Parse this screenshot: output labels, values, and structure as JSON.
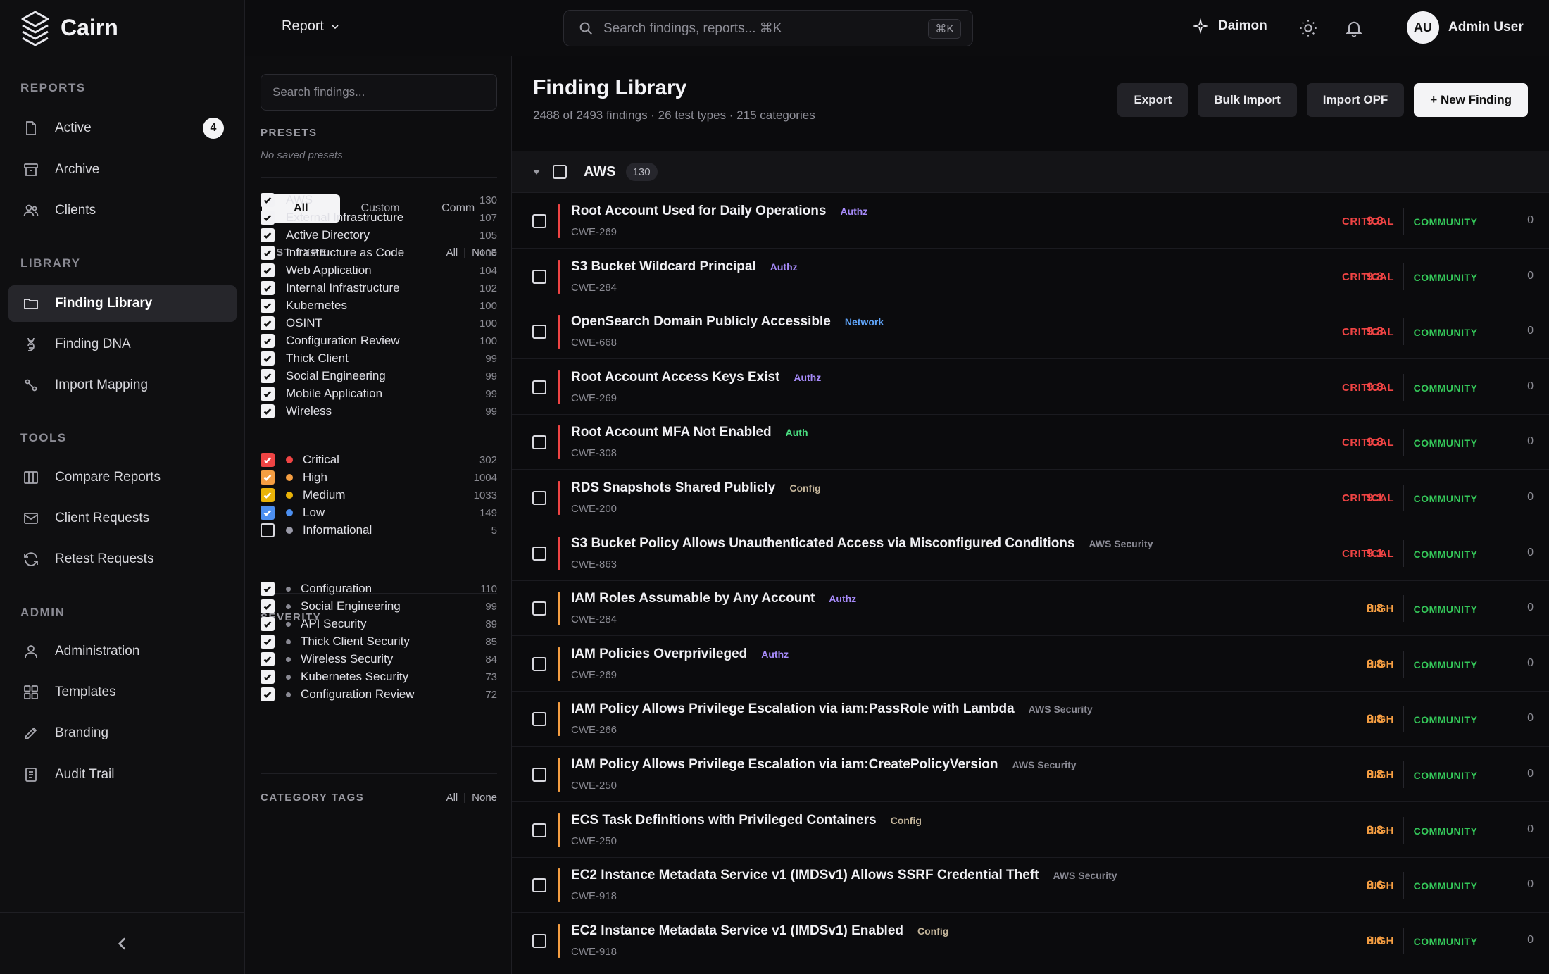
{
  "app": {
    "name": "Cairn"
  },
  "topbar": {
    "report_menu": "Report",
    "search_placeholder": "Search findings, reports... ⌘K",
    "search_shortcut": "⌘K",
    "assistant": "Daimon",
    "user_initials": "AU",
    "user_name": "Admin User"
  },
  "sidebar": {
    "sections": {
      "reports": "REPORTS",
      "library": "LIBRARY",
      "tools": "TOOLS",
      "admin": "ADMIN"
    },
    "items": [
      {
        "label": "Active",
        "icon": "document-icon",
        "badge": "4"
      },
      {
        "label": "Archive",
        "icon": "archive-icon"
      },
      {
        "label": "Clients",
        "icon": "users-icon"
      },
      {
        "label": "Finding Library",
        "icon": "folder-icon",
        "active": true
      },
      {
        "label": "Finding DNA",
        "icon": "dna-icon"
      },
      {
        "label": "Import Mapping",
        "icon": "mapping-icon"
      },
      {
        "label": "Compare Reports",
        "icon": "columns-icon"
      },
      {
        "label": "Client Requests",
        "icon": "mail-icon"
      },
      {
        "label": "Retest Requests",
        "icon": "refresh-icon"
      },
      {
        "label": "Administration",
        "icon": "user-icon"
      },
      {
        "label": "Templates",
        "icon": "grid-icon"
      },
      {
        "label": "Branding",
        "icon": "pen-icon"
      },
      {
        "label": "Audit Trail",
        "icon": "clipboard-icon"
      }
    ]
  },
  "filters": {
    "search_placeholder": "Search findings...",
    "presets_label": "PRESETS",
    "presets_empty": "No saved presets",
    "scope_tabs": [
      "All",
      "Custom",
      "Comm"
    ],
    "test_type_label": "TEST TYPE",
    "all": "All",
    "none": "None",
    "test_types": [
      {
        "label": "AWS",
        "count": "130"
      },
      {
        "label": "External Infrastructure",
        "count": "107"
      },
      {
        "label": "Active Directory",
        "count": "105"
      },
      {
        "label": "Infrastructure as Code",
        "count": "105"
      },
      {
        "label": "Web Application",
        "count": "104"
      },
      {
        "label": "Internal Infrastructure",
        "count": "102"
      },
      {
        "label": "Kubernetes",
        "count": "100"
      },
      {
        "label": "OSINT",
        "count": "100"
      },
      {
        "label": "Configuration Review",
        "count": "100"
      },
      {
        "label": "Thick Client",
        "count": "99"
      },
      {
        "label": "Social Engineering",
        "count": "99"
      },
      {
        "label": "Mobile Application",
        "count": "99"
      },
      {
        "label": "Wireless",
        "count": "99"
      }
    ],
    "severity_label": "SEVERITY",
    "severities": [
      {
        "label": "Critical",
        "count": "302",
        "color": "#ef4444",
        "checked": true
      },
      {
        "label": "High",
        "count": "1004",
        "color": "#f59e42",
        "checked": true
      },
      {
        "label": "Medium",
        "count": "1033",
        "color": "#eab308",
        "checked": true
      },
      {
        "label": "Low",
        "count": "149",
        "color": "#4c8ff0",
        "checked": true
      },
      {
        "label": "Informational",
        "count": "5",
        "color": "#9a9aa8",
        "checked": false
      }
    ],
    "category_label": "CATEGORY TAGS",
    "categories": [
      {
        "label": "Configuration",
        "count": "110"
      },
      {
        "label": "Social Engineering",
        "count": "99"
      },
      {
        "label": "API Security",
        "count": "89"
      },
      {
        "label": "Thick Client Security",
        "count": "85"
      },
      {
        "label": "Wireless Security",
        "count": "84"
      },
      {
        "label": "Kubernetes Security",
        "count": "73"
      },
      {
        "label": "Configuration Review",
        "count": "72"
      }
    ]
  },
  "main": {
    "title": "Finding Library",
    "subtitle": "2488 of 2493 findings · 26 test types · 215 categories",
    "actions": {
      "export": "Export",
      "bulk_import": "Bulk Import",
      "import_opf": "Import OPF",
      "new_finding": "+ New Finding"
    },
    "group": {
      "name": "AWS",
      "count": "130"
    },
    "findings": [
      {
        "title": "Root Account Used for Daily Operations",
        "tag": "Authz",
        "cwe": "CWE-269",
        "severity": "CRITICAL",
        "score": "9.8",
        "source": "COMMUNITY",
        "uses": "0"
      },
      {
        "title": "S3 Bucket Wildcard Principal",
        "tag": "Authz",
        "cwe": "CWE-284",
        "severity": "CRITICAL",
        "score": "9.8",
        "source": "COMMUNITY",
        "uses": "0"
      },
      {
        "title": "OpenSearch Domain Publicly Accessible",
        "tag": "Network",
        "cwe": "CWE-668",
        "severity": "CRITICAL",
        "score": "9.8",
        "source": "COMMUNITY",
        "uses": "0"
      },
      {
        "title": "Root Account Access Keys Exist",
        "tag": "Authz",
        "cwe": "CWE-269",
        "severity": "CRITICAL",
        "score": "9.8",
        "source": "COMMUNITY",
        "uses": "0"
      },
      {
        "title": "Root Account MFA Not Enabled",
        "tag": "Auth",
        "cwe": "CWE-308",
        "severity": "CRITICAL",
        "score": "9.8",
        "source": "COMMUNITY",
        "uses": "0"
      },
      {
        "title": "RDS Snapshots Shared Publicly",
        "tag": "Config",
        "cwe": "CWE-200",
        "severity": "CRITICAL",
        "score": "9.1",
        "source": "COMMUNITY",
        "uses": "0"
      },
      {
        "title": "S3 Bucket Policy Allows Unauthenticated Access via Misconfigured Conditions",
        "tag": "AWS Security",
        "cwe": "CWE-863",
        "severity": "CRITICAL",
        "score": "9.1",
        "source": "COMMUNITY",
        "uses": "0"
      },
      {
        "title": "IAM Roles Assumable by Any Account",
        "tag": "Authz",
        "cwe": "CWE-284",
        "severity": "HIGH",
        "score": "8.8",
        "source": "COMMUNITY",
        "uses": "0"
      },
      {
        "title": "IAM Policies Overprivileged",
        "tag": "Authz",
        "cwe": "CWE-269",
        "severity": "HIGH",
        "score": "8.8",
        "source": "COMMUNITY",
        "uses": "0"
      },
      {
        "title": "IAM Policy Allows Privilege Escalation via iam:PassRole with Lambda",
        "tag": "AWS Security",
        "cwe": "CWE-266",
        "severity": "HIGH",
        "score": "8.8",
        "source": "COMMUNITY",
        "uses": "0"
      },
      {
        "title": "IAM Policy Allows Privilege Escalation via iam:CreatePolicyVersion",
        "tag": "AWS Security",
        "cwe": "CWE-250",
        "severity": "HIGH",
        "score": "8.8",
        "source": "COMMUNITY",
        "uses": "0"
      },
      {
        "title": "ECS Task Definitions with Privileged Containers",
        "tag": "Config",
        "cwe": "CWE-250",
        "severity": "HIGH",
        "score": "8.8",
        "source": "COMMUNITY",
        "uses": "0"
      },
      {
        "title": "EC2 Instance Metadata Service v1 (IMDSv1) Allows SSRF Credential Theft",
        "tag": "AWS Security",
        "cwe": "CWE-918",
        "severity": "HIGH",
        "score": "8.6",
        "source": "COMMUNITY",
        "uses": "0"
      },
      {
        "title": "EC2 Instance Metadata Service v1 (IMDSv1) Enabled",
        "tag": "Config",
        "cwe": "CWE-918",
        "severity": "HIGH",
        "score": "8.6",
        "source": "COMMUNITY",
        "uses": "0"
      }
    ],
    "colors": {
      "critical": "#ef4444",
      "high": "#f59e42",
      "community": "#34c759",
      "tag_authz": "#a78bfa",
      "tag_network": "#60a5fa",
      "tag_auth": "#4ade80",
      "tag_config": "#c4b59a",
      "tag_aws": "#8a8a94"
    }
  }
}
